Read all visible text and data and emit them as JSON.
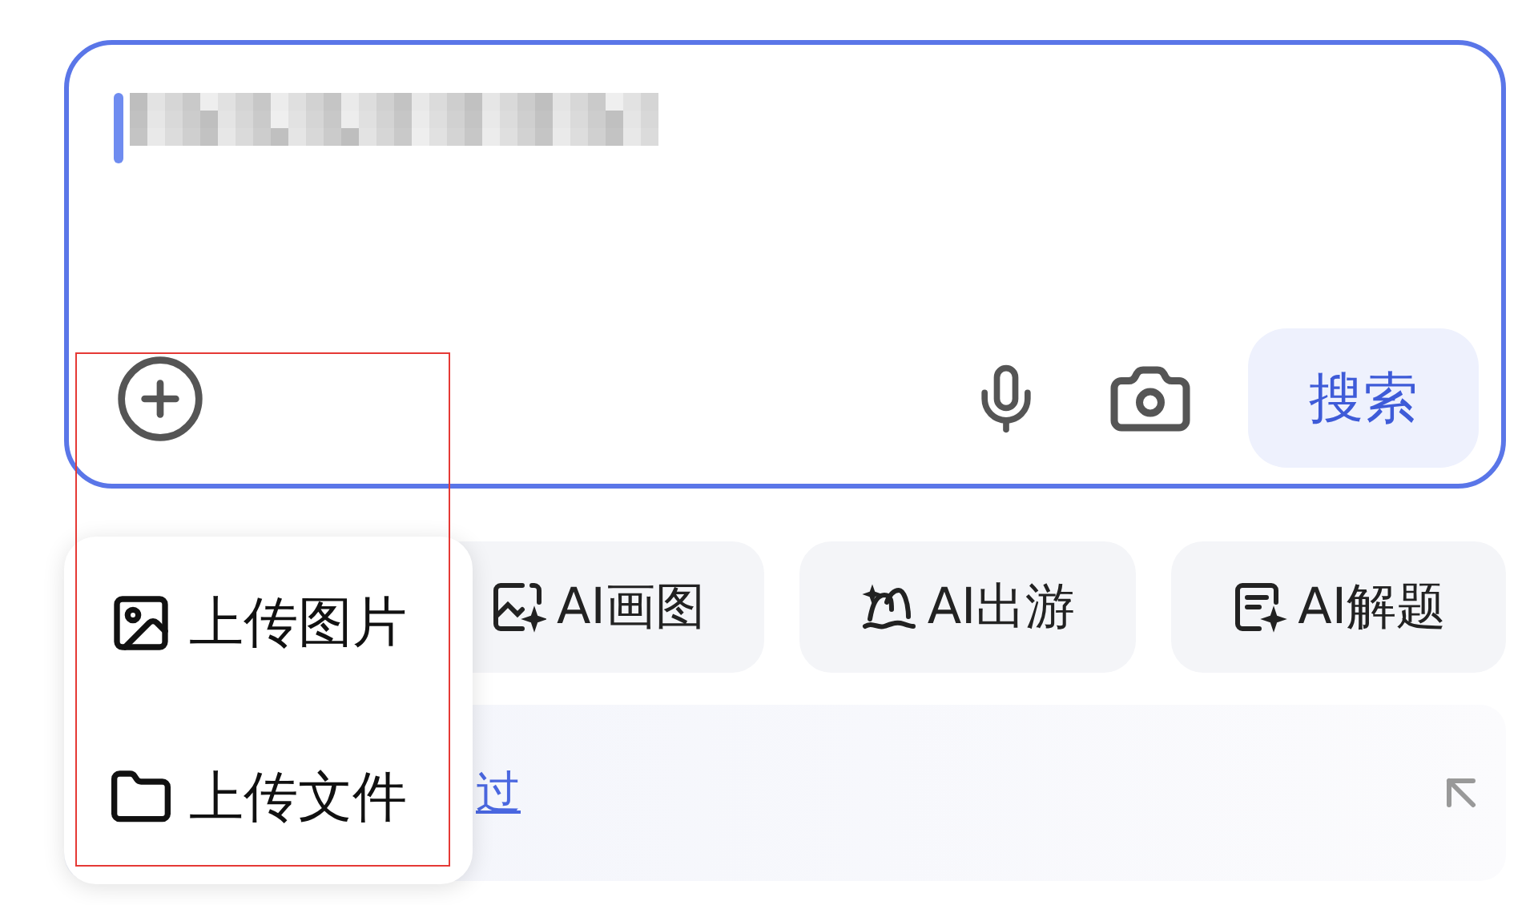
{
  "search_box": {
    "focused": true,
    "submit": "搜索"
  },
  "chips": [
    {
      "label": "AI画图",
      "kind": "draw"
    },
    {
      "label": "AI出游",
      "kind": "travel"
    },
    {
      "label": "AI解题",
      "kind": "solve"
    }
  ],
  "suggestion": {
    "link": "过"
  },
  "attach_menu": {
    "items": [
      {
        "label": "上传图片",
        "kind": "image"
      },
      {
        "label": "上传文件",
        "kind": "file"
      }
    ]
  }
}
